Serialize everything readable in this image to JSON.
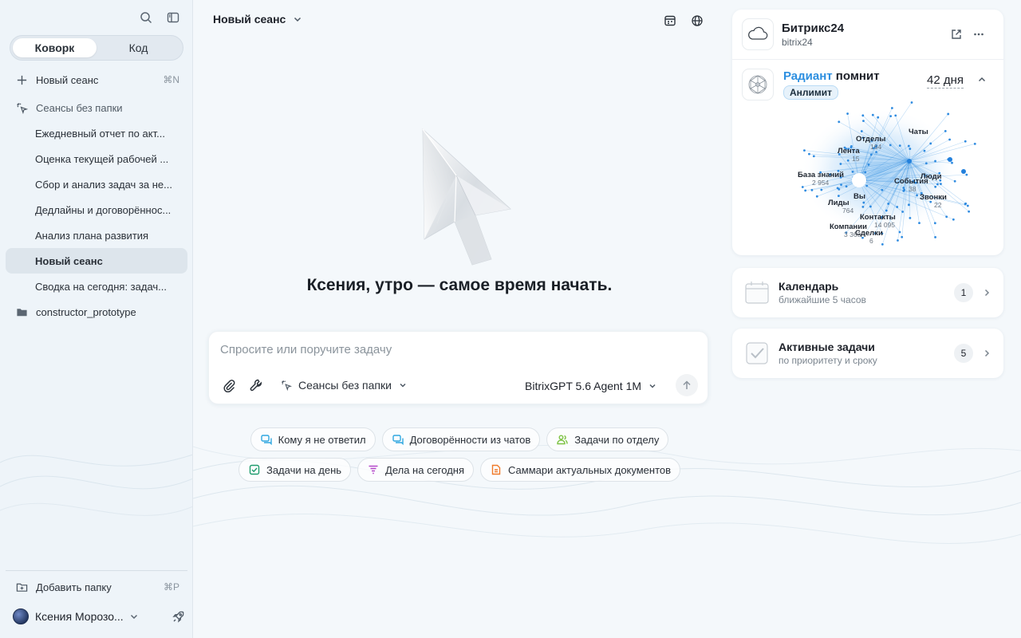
{
  "sidebar": {
    "tabs": [
      {
        "label": "Коворк",
        "active": true
      },
      {
        "label": "Код",
        "active": false
      }
    ],
    "new_session": {
      "label": "Новый сеанс",
      "shortcut": "⌘N"
    },
    "no_folder": {
      "label": "Сеансы без папки"
    },
    "sessions": [
      {
        "label": "Ежедневный отчет по акт..."
      },
      {
        "label": "Оценка текущей рабочей ..."
      },
      {
        "label": "Сбор и анализ задач за не..."
      },
      {
        "label": "Дедлайны и договорённос..."
      },
      {
        "label": "Анализ плана развития"
      },
      {
        "label": "Новый сеанс",
        "selected": true
      },
      {
        "label": "Сводка на сегодня: задач..."
      }
    ],
    "folder": {
      "label": "constructor_prototype"
    },
    "add_folder": {
      "label": "Добавить папку",
      "shortcut": "⌘P"
    },
    "user": {
      "name": "Ксения Морозо..."
    }
  },
  "main": {
    "session_title": "Новый сеанс",
    "greeting": "Ксения, утро — самое время начать.",
    "composer": {
      "placeholder": "Спросите или поручите задачу",
      "folder_select": "Сеансы без папки",
      "model_select": "BitrixGPT 5.6 Agent 1M"
    },
    "chips_row1": [
      {
        "label": "Кому я не ответил",
        "icon": "chat-icon",
        "color": "#2fa7e0"
      },
      {
        "label": "Договорённости из чатов",
        "icon": "chat-icon",
        "color": "#2fa7e0"
      },
      {
        "label": "Задачи по отделу",
        "icon": "users-icon",
        "color": "#7cc242"
      }
    ],
    "chips_row2": [
      {
        "label": "Задачи на день",
        "icon": "checkbox-icon",
        "color": "#1f9c6e"
      },
      {
        "label": "Дела на сегодня",
        "icon": "filter-icon",
        "color": "#b347c9"
      },
      {
        "label": "Саммари актуальных документов",
        "icon": "document-icon",
        "color": "#f07a2a"
      }
    ]
  },
  "right": {
    "b24": {
      "title": "Битрикс24",
      "subtitle": "bitrix24"
    },
    "memory": {
      "brand": "Радиант",
      "title_rest": " помнит",
      "badge": "Анлимит",
      "days": "42 дня",
      "graph": {
        "center": "Вы",
        "nodes": [
          {
            "label": "Чаты",
            "count": ""
          },
          {
            "label": "Отделы",
            "count": "164"
          },
          {
            "label": "Лента",
            "count": "15"
          },
          {
            "label": "База знаний",
            "count": "2 954"
          },
          {
            "label": "События",
            "count": "38"
          },
          {
            "label": "Люди",
            "count": ""
          },
          {
            "label": "Звонки",
            "count": "22"
          },
          {
            "label": "Лиды",
            "count": "764"
          },
          {
            "label": "Контакты",
            "count": "14 095"
          },
          {
            "label": "Компании",
            "count": "3 369"
          },
          {
            "label": "Сделки",
            "count": "6"
          }
        ]
      }
    },
    "calendar": {
      "title": "Календарь",
      "subtitle": "ближайшие 5 часов",
      "count": "1"
    },
    "tasks": {
      "title": "Активные задачи",
      "subtitle": "по приоритету и сроку",
      "count": "5"
    }
  }
}
